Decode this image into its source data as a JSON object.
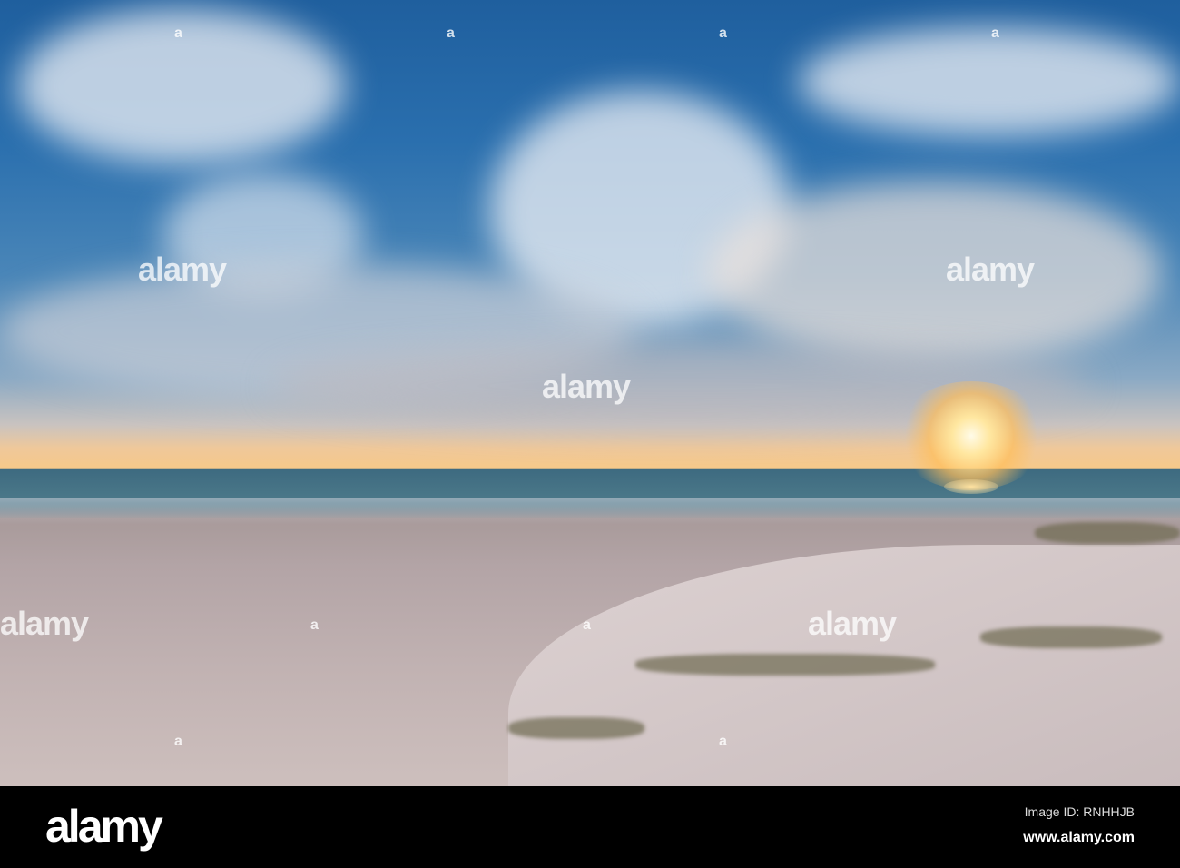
{
  "photo": {
    "subject": "Sunset over beach with sand dunes"
  },
  "watermark": {
    "text": "alamy",
    "marker": "a"
  },
  "footer": {
    "logo": "alamy",
    "image_id": "Image ID: RNHHJB",
    "url": "www.alamy.com"
  }
}
